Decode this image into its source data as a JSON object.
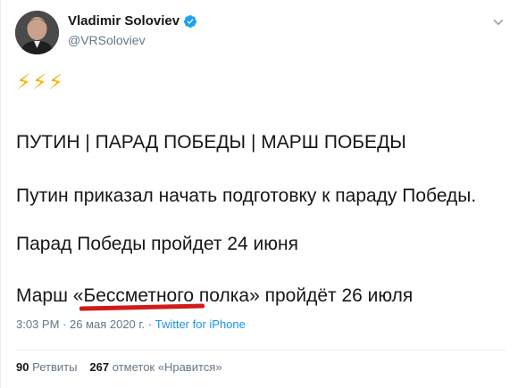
{
  "author": {
    "name": "Vladimir Soloviev",
    "handle": "@VRSoloviev"
  },
  "tweet": {
    "emoji": "⚡⚡⚡",
    "line1": "ПУТИН | ПАРАД ПОБЕДЫ | МАРШ ПОБЕДЫ",
    "line2": "Путин приказал начать подготовку к параду Победы.",
    "line3": "Парад Победы пройдет 24 июня",
    "line4": "Марш «Бессметного полка» пройдёт 26 июля"
  },
  "meta": {
    "time_date": "3:03 PM · 26 мая 2020 г. · ",
    "source": "Twitter for iPhone"
  },
  "stats": {
    "retweets_count": "90",
    "retweets_label": "Ретвиты",
    "likes_count": "267",
    "likes_label": "отметок «Нравится»"
  },
  "colors": {
    "verified": "#1da1f2",
    "link": "#1b95e0",
    "underline": "#d11a1a"
  }
}
